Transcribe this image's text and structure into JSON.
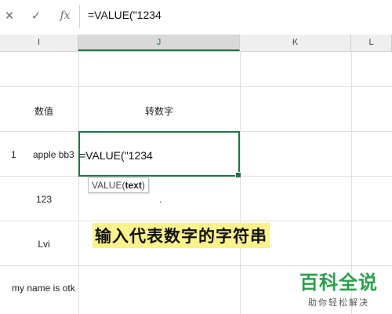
{
  "formula_bar": {
    "cancel_icon": "close-icon",
    "enter_icon": "check-icon",
    "function_icon": "fx-icon",
    "cancel_glyph": "✕",
    "enter_glyph": "✓",
    "function_glyph": "fx",
    "formula": "=VALUE(\"1234"
  },
  "columns": [
    {
      "label": "I",
      "active": false
    },
    {
      "label": "J",
      "active": true
    },
    {
      "label": "K",
      "active": false
    },
    {
      "label": "L",
      "active": false
    }
  ],
  "cells": {
    "header_i": "数值",
    "header_j": "转数字",
    "row1_index": "1",
    "row1_value": "apple bb3",
    "row2_value": "123",
    "row3_value": "Lvi",
    "row4_value": "my name is otk",
    "row2_j_dot": "."
  },
  "edit_cell": {
    "text": "=VALUE(\"1234",
    "tooltip_fn": "VALUE(",
    "tooltip_arg": "text",
    "tooltip_close": ")"
  },
  "annotation": "输入代表数字的字符串",
  "watermark": {
    "title": "百科全说",
    "subtitle": "助你轻松解决"
  },
  "colors": {
    "accent": "#217346",
    "highlight": "#fbf28a",
    "watermark": "#2aa04a"
  }
}
